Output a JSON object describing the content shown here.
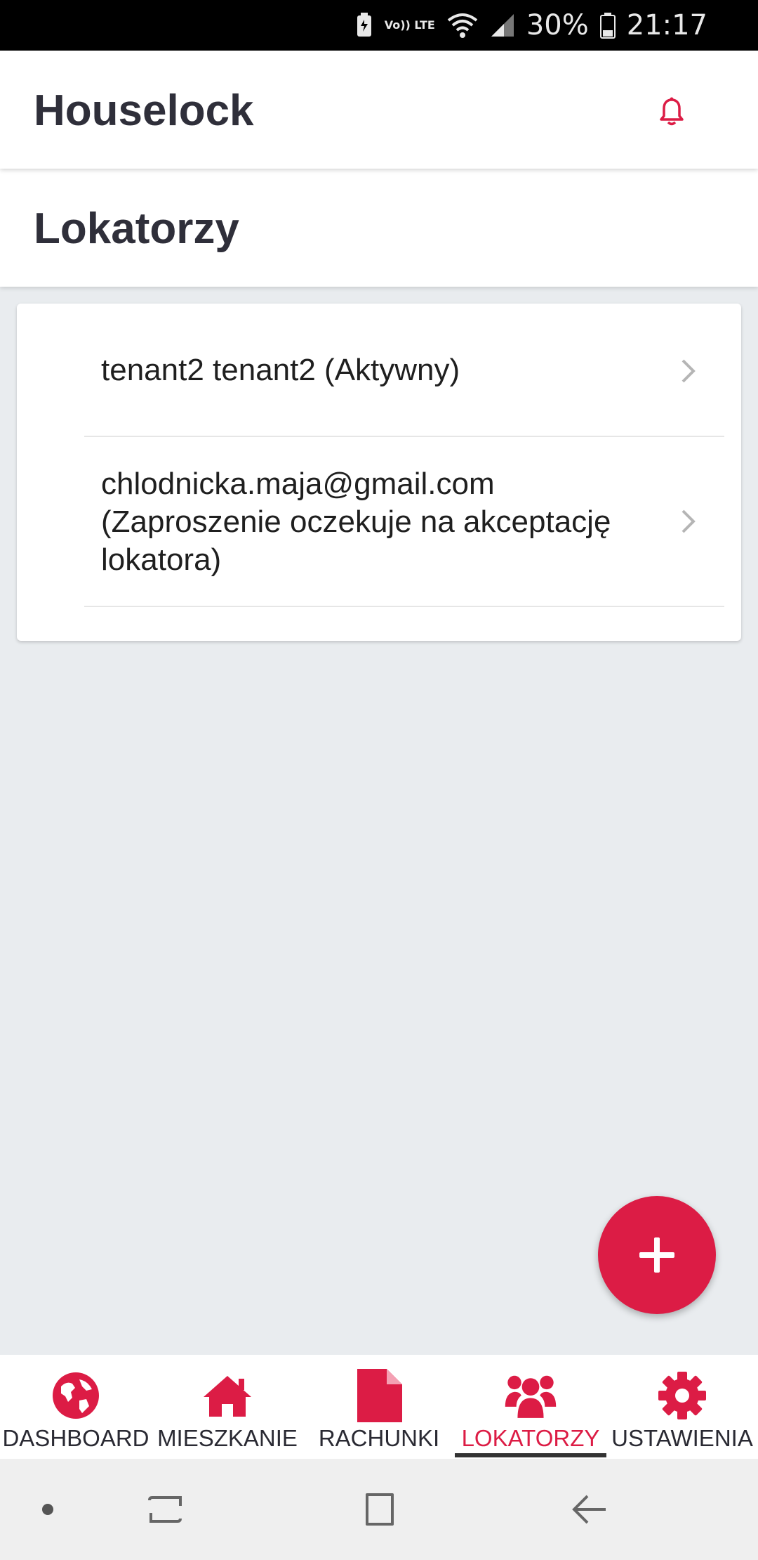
{
  "status_bar": {
    "volte": "Vo)) LTE",
    "battery": "30%",
    "time": "21:17"
  },
  "header": {
    "app_title": "Houselock",
    "notification_icon": "bell-icon"
  },
  "section": {
    "title": "Lokatorzy"
  },
  "tenants": [
    {
      "label": "tenant2 tenant2 (Aktywny)"
    },
    {
      "label": "chlodnicka.maja@gmail.com (Zaproszenie oczekuje na akceptację lokatora)"
    }
  ],
  "fab": {
    "icon": "plus-icon"
  },
  "bottom_nav": {
    "items": [
      {
        "label": "DASHBOARD",
        "icon": "globe-icon"
      },
      {
        "label": "MIESZKANIE",
        "icon": "home-icon"
      },
      {
        "label": "RACHUNKI",
        "icon": "document-icon"
      },
      {
        "label": "LOKATORZY",
        "icon": "users-icon",
        "active": true
      },
      {
        "label": "USTAWIENIA",
        "icon": "gear-icon"
      }
    ]
  },
  "system_nav": {
    "buttons": [
      "dot-icon",
      "recents-icon",
      "home-square-icon",
      "back-icon"
    ]
  },
  "colors": {
    "accent": "#dc1c45",
    "background": "#e9ecef",
    "text": "#2f2f3a"
  }
}
